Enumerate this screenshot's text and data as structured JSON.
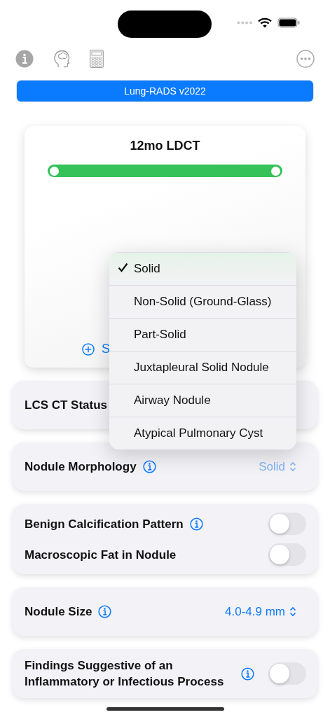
{
  "version_button": {
    "label": "Lung-RADS v2022"
  },
  "result": {
    "recommendation": "12mo LDCT",
    "action": "S"
  },
  "sections": [
    {
      "rows": [
        {
          "kind": "menu",
          "label": "LCS CT Status",
          "info": false
        }
      ]
    },
    {
      "rows": [
        {
          "kind": "menu",
          "label": "Nodule Morphology",
          "info": true,
          "value": "Solid",
          "dimmed": true
        }
      ]
    },
    {
      "rows": [
        {
          "kind": "toggle",
          "label": "Benign Calcification Pattern",
          "info": true,
          "on": false
        },
        {
          "kind": "toggle",
          "label": "Macroscopic Fat in Nodule",
          "info": false,
          "on": false
        }
      ]
    },
    {
      "rows": [
        {
          "kind": "menu",
          "label": "Nodule Size",
          "info": true,
          "value": "4.0-4.9 mm",
          "dimmed": false
        }
      ]
    },
    {
      "rows": [
        {
          "kind": "toggle",
          "label": "Findings Suggestive of an Inflammatory or Infectious Process",
          "info": true,
          "on": false
        }
      ]
    }
  ],
  "menu": {
    "items": [
      {
        "label": "Solid",
        "selected": true
      },
      {
        "label": "Non-Solid (Ground-Glass)",
        "selected": false
      },
      {
        "label": "Part-Solid",
        "selected": false
      },
      {
        "label": "Juxtapleural Solid Nodule",
        "selected": false
      },
      {
        "label": "Airway Nodule",
        "selected": false
      },
      {
        "label": "Atypical Pulmonary Cyst",
        "selected": false
      }
    ]
  }
}
